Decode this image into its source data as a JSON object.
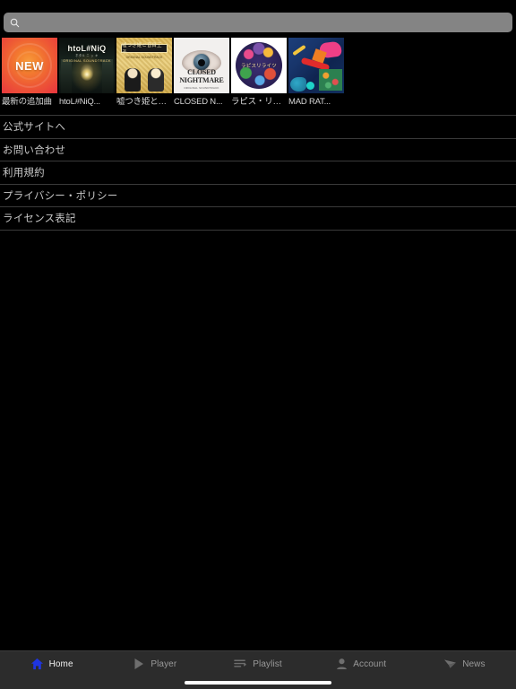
{
  "search": {
    "placeholder": "",
    "value": "",
    "icon": "search-icon"
  },
  "shelf": {
    "items": [
      {
        "label": "最新の追加曲",
        "art": "new-badge",
        "badge_text": "NEW"
      },
      {
        "label": "htoL#NiQ...",
        "art": "htol-niq",
        "title_text": "htoL#NiQ",
        "sub_text": "ホタル ニ ッ キ",
        "sub2_text": "ORIGINAL SOUNDTRACK"
      },
      {
        "label": "嘘つき姫と…",
        "art": "usotsuki-hime",
        "title_text": "嘘つき姫と盲目王子",
        "sub_text": "ORIGINAL SOUNDTRACK"
      },
      {
        "label": "CLOSED N...",
        "art": "closed-nightmare",
        "title_text": "CLOSED NIGHTMARE",
        "sub_text": "ORIGINAL SOUNDTRACK"
      },
      {
        "label": "ラピス・リ…",
        "art": "lapis-re-abyss",
        "title_text": "ラピスリライツ"
      },
      {
        "label": "MAD RAT...",
        "art": "mad-rat-dead"
      }
    ]
  },
  "menu": {
    "items": [
      {
        "label": "公式サイトへ"
      },
      {
        "label": "お問い合わせ"
      },
      {
        "label": "利用規約"
      },
      {
        "label": "プライバシー・ポリシー"
      },
      {
        "label": "ライセンス表記"
      }
    ]
  },
  "tabbar": {
    "active_index": 0,
    "active_color": "#1f35e0",
    "inactive_color": "#9a9a9a",
    "items": [
      {
        "label": "Home",
        "icon": "home-icon"
      },
      {
        "label": "Player",
        "icon": "play-triangle-icon"
      },
      {
        "label": "Playlist",
        "icon": "playlist-lines-icon"
      },
      {
        "label": "Account",
        "icon": "person-icon"
      },
      {
        "label": "News",
        "icon": "paper-plane-icon"
      }
    ]
  },
  "colors": {
    "background": "#000000",
    "search_field": "#848484",
    "tabbar_background": "#2c2c2c",
    "divider": "#3a3a3a",
    "menu_text": "#c8c8c8"
  }
}
